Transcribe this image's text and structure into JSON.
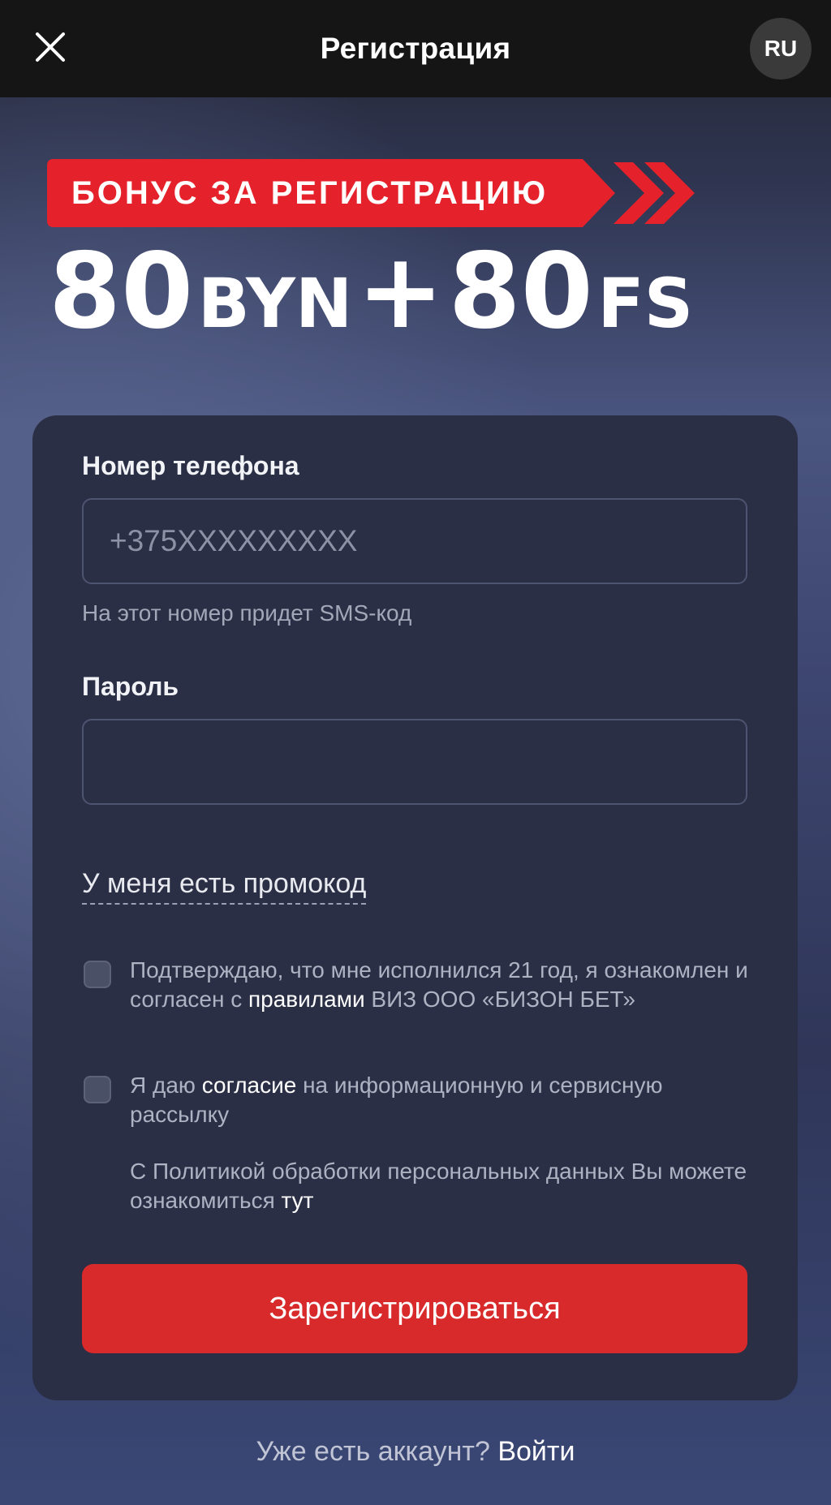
{
  "header": {
    "title": "Регистрация",
    "language": "RU",
    "close_icon": "close-icon"
  },
  "promo": {
    "banner_text": "БОНУС ЗА РЕГИСТРАЦИЮ",
    "amount_primary": "80",
    "currency": "BYN",
    "plus": "+",
    "amount_secondary": "80",
    "spins_unit": "FS",
    "accent_color": "#e5222b"
  },
  "form": {
    "phone": {
      "label": "Номер телефона",
      "placeholder": "+375XXXXXXXXX",
      "value": "",
      "hint": "На этот номер придет SMS-код"
    },
    "password": {
      "label": "Пароль",
      "value": ""
    },
    "promo_link": "У меня есть промокод",
    "age_consent": {
      "text_before": "Подтверждаю, что мне исполнился 21 год, я ознакомлен и согласен с ",
      "link": "правилами",
      "text_after": " ВИЗ ООО «БИЗОН БЕТ»",
      "checked": false
    },
    "mailing_consent": {
      "text_before": "Я даю ",
      "link": "согласие",
      "text_after": " на информационную и сервисную рассылку",
      "checked": false
    },
    "policy": {
      "text_before": "С Политикой обработки персональных данных Вы можете ознакомиться ",
      "link": "тут"
    },
    "submit_label": "Зарегистрироваться",
    "submit_color": "#d8292b"
  },
  "footer": {
    "question": "Уже есть аккаунт?",
    "login_link": "Войти"
  }
}
